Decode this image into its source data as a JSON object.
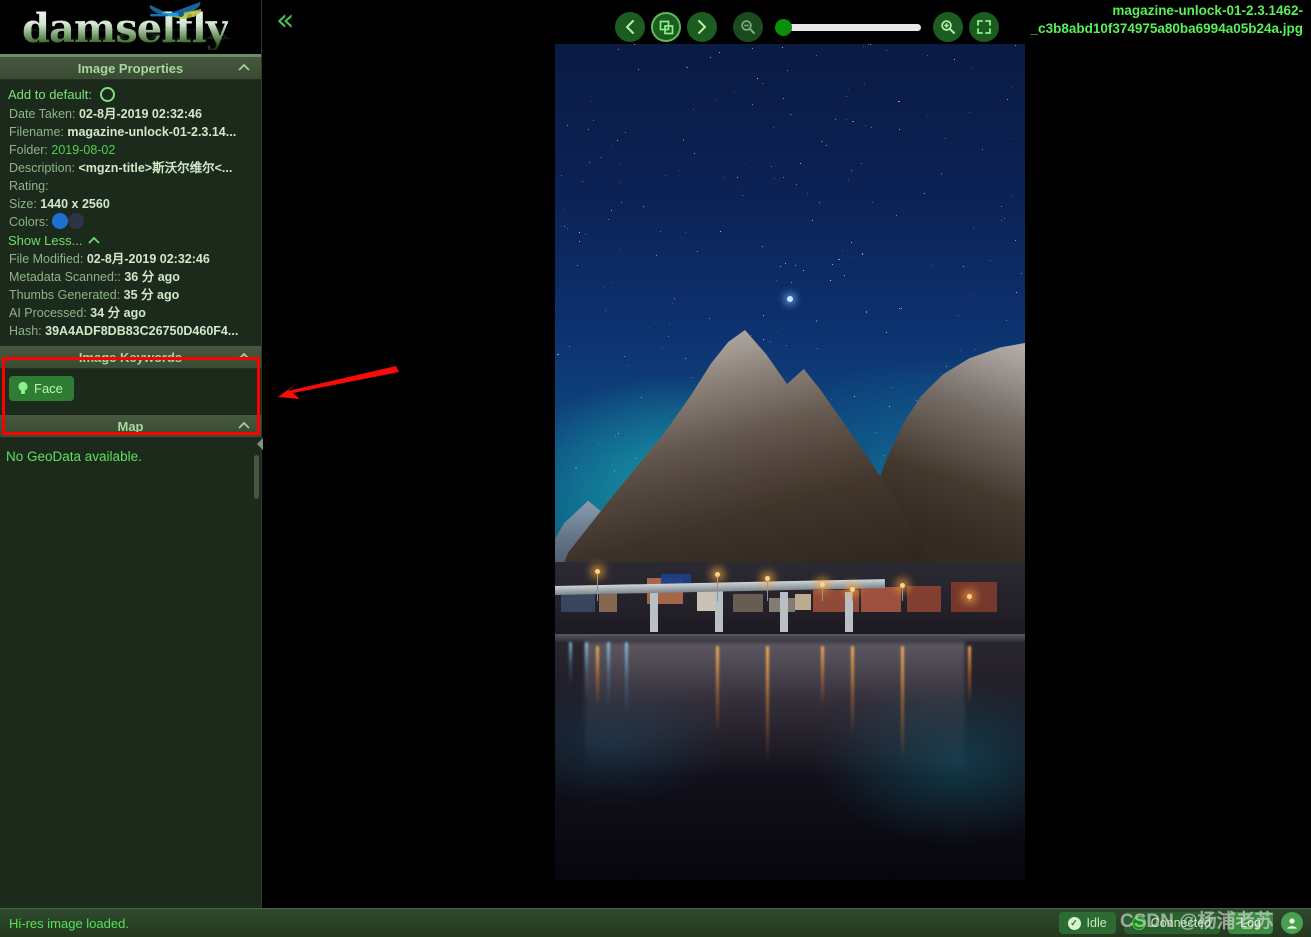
{
  "app": {
    "logo_text": "damselfly",
    "logo_icon": "dragonfly-icon"
  },
  "sidebar": {
    "properties_panel": {
      "title": "Image Properties",
      "collapse_icon": "chevron-up-icon",
      "add_to_default_label": "Add to default:",
      "add_to_default_icon": "circle-outline-icon",
      "rows": [
        {
          "label": "Date Taken:",
          "value": "02-8月-2019 02:32:46",
          "style": "bold"
        },
        {
          "label": "Filename:",
          "value": "magazine-unlock-01-2.3.14...",
          "style": "bold"
        },
        {
          "label": "Folder:",
          "value": "2019-08-02",
          "style": "green"
        },
        {
          "label": "Description:",
          "value": "<mgzn-title>斯沃尔维尔<...",
          "style": "bold"
        },
        {
          "label": "Rating:",
          "value": "",
          "style": "bold"
        },
        {
          "label": "Size:",
          "value": "1440 x 2560",
          "style": "bold"
        }
      ],
      "colors_label": "Colors:",
      "colors": [
        "#1f6fd0",
        "#2d3447"
      ],
      "show_less_label": "Show Less...",
      "show_less_icon": "chevron-up-icon",
      "extra_rows": [
        {
          "label": "File Modified:",
          "value": "02-8月-2019 02:32:46",
          "style": "bold"
        },
        {
          "label": "Metadata Scanned::",
          "value": "36 分 ago",
          "style": "bold"
        },
        {
          "label": "Thumbs Generated:",
          "value": "35 分 ago",
          "style": "bold"
        },
        {
          "label": "AI Processed:",
          "value": "34 分 ago",
          "style": "bold"
        },
        {
          "label": "Hash:",
          "value": "39A4ADF8DB83C26750D460F4...",
          "style": "bold"
        }
      ]
    },
    "keywords_panel": {
      "title": "Image Keywords",
      "collapse_icon": "chevron-up-icon",
      "chips": [
        {
          "label": "Face",
          "icon": "lightbulb-icon"
        }
      ]
    },
    "map_panel": {
      "title": "Map",
      "collapse_icon": "chevron-up-icon",
      "message": "No GeoData available."
    },
    "collapse_handle_icon": "triangle-left-icon"
  },
  "toolbar": {
    "collapse_icon": "double-chevron-left-icon",
    "collapse_label": "«",
    "buttons": [
      {
        "name": "previous-image",
        "icon": "chevron-left-icon",
        "glyph": "‹",
        "active": false
      },
      {
        "name": "transform-crop",
        "icon": "crop-transform-icon",
        "glyph": "",
        "active": true
      },
      {
        "name": "next-image",
        "icon": "chevron-right-icon",
        "glyph": "›",
        "active": false
      }
    ],
    "zoom_out_icon": "magnifier-minus-icon",
    "zoom_in_icon": "magnifier-plus-icon",
    "fullscreen_icon": "fullscreen-icon",
    "zoom_slider_value": 0
  },
  "image_title": {
    "line1": "magazine-unlock-01-2.3.1462-",
    "line2": "_c3b8abd10f374975a80ba6994a05b24a.jpg"
  },
  "photo": {
    "alt": "night-harbour-mountain-photo"
  },
  "statusbar": {
    "message": "Hi-res image loaded.",
    "idle_label": "Idle",
    "idle_icon": "check-circle-icon",
    "connected_label": "Connected",
    "connected_icon": "green-dot-icon",
    "log_label": "Log",
    "user_icon": "user-avatar-icon"
  },
  "annotations": {
    "watermark": "CSDN @杨浦老苏",
    "arrow": "red-arrow-pointing-left",
    "highlight_box": "red-rectangle-around-image-keywords"
  },
  "colors": {
    "accent_green": "#59ef59",
    "panel_header": "#3e4f37",
    "sidebar_bg": "#1c2a1b",
    "highlight_red": "#ff0000",
    "chip_green": "#2e7d32"
  }
}
